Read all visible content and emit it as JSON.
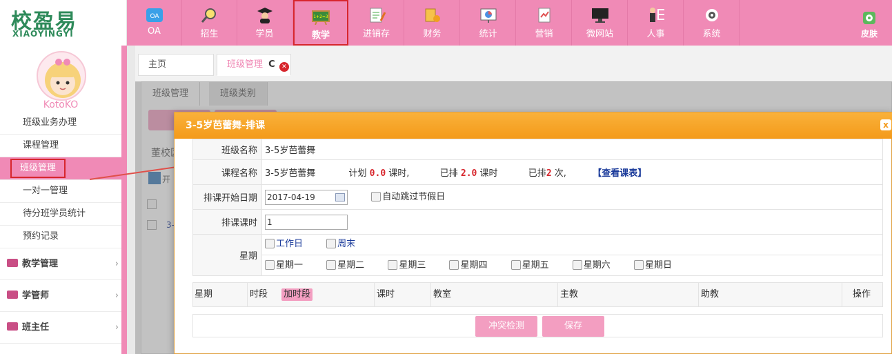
{
  "logo": {
    "main": "校盈易",
    "sub": "XIAOYINGYI"
  },
  "nav": [
    {
      "label": "OA",
      "icon": "oa-icon"
    },
    {
      "label": "招生",
      "icon": "magnifier-icon"
    },
    {
      "label": "学员",
      "icon": "graduate-icon"
    },
    {
      "label": "教学",
      "icon": "blackboard-icon",
      "active": true
    },
    {
      "label": "进销存",
      "icon": "inventory-icon"
    },
    {
      "label": "财务",
      "icon": "finance-icon"
    },
    {
      "label": "统计",
      "icon": "statistics-icon"
    },
    {
      "label": "营销",
      "icon": "marketing-icon"
    },
    {
      "label": "微网站",
      "icon": "monitor-icon"
    },
    {
      "label": "人事",
      "icon": "personnel-icon"
    },
    {
      "label": "系统",
      "icon": "gear-icon"
    }
  ],
  "skin": {
    "label": "皮肤"
  },
  "user": {
    "name": "KotoKO"
  },
  "sidebar": {
    "items": [
      {
        "label": "班级业务办理"
      },
      {
        "label": "课程管理"
      },
      {
        "label": "班级管理",
        "active": true
      },
      {
        "label": "一对一管理"
      },
      {
        "label": "待分班学员统计"
      },
      {
        "label": "预约记录"
      }
    ],
    "groups": [
      {
        "label": "教学管理"
      },
      {
        "label": "学管师"
      },
      {
        "label": "班主任"
      }
    ]
  },
  "tabs": {
    "home": "主页",
    "class_mgmt": "班级管理",
    "refresh": "C",
    "close": "✕"
  },
  "subtabs": {
    "class_mgmt": "班级管理",
    "class_type": "班级类别"
  },
  "background": {
    "school": "董校区",
    "open": "开",
    "row_text": "3-"
  },
  "dialog": {
    "title": "3-5岁芭蕾舞-排课",
    "close": "x",
    "class_name_label": "班级名称",
    "class_name_value": "3-5岁芭蕾舞",
    "course_name_label": "课程名称",
    "course_name_value": "3-5岁芭蕾舞",
    "plan_prefix": "计划",
    "plan_value": "0.0",
    "plan_unit": "课时,",
    "scheduled_prefix": "已排",
    "scheduled_value": "2.0",
    "scheduled_unit": "课时",
    "times_prefix": "已排",
    "times_value": "2",
    "times_unit": "次,",
    "view_schedule": "【查看课表】",
    "start_date_label": "排课开始日期",
    "start_date_value": "2017-04-19",
    "skip_holiday": "自动跳过节假日",
    "hours_label": "排课课时",
    "hours_value": "1",
    "week_label": "星期",
    "workday": "工作日",
    "weekend": "周末",
    "days": [
      "星期一",
      "星期二",
      "星期三",
      "星期四",
      "星期五",
      "星期六",
      "星期日"
    ],
    "grid": {
      "week": "星期",
      "period": "时段",
      "add_period": "加时段",
      "hours": "课时",
      "room": "教室",
      "teacher": "主教",
      "assistant": "助教",
      "action": "操作"
    },
    "conflict_button": "冲突检测",
    "save_button": "保存"
  },
  "colors": {
    "accent": "#f08ab6",
    "dialog_header": "#f49a1a",
    "highlight_border": "#d7262d"
  }
}
